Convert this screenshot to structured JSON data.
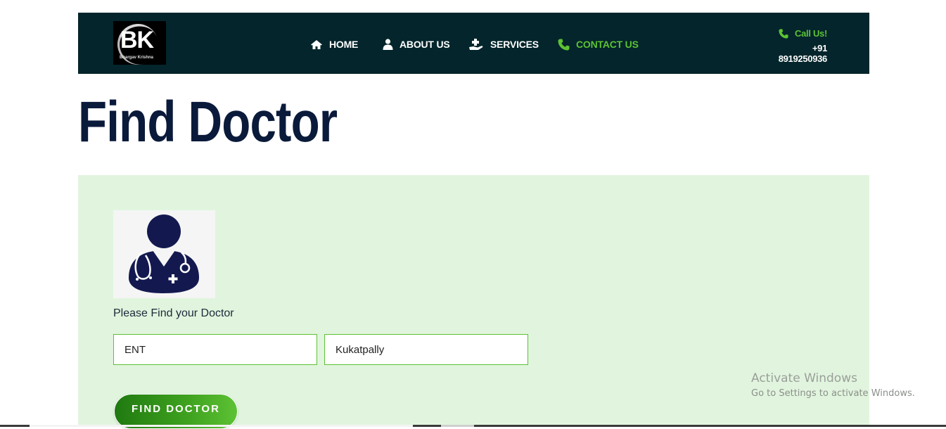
{
  "logo": {
    "letters": "BK",
    "subtitle": "Bhargav Krishna"
  },
  "nav": {
    "home": "HOME",
    "about": "ABOUT US",
    "services": "SERVICES",
    "contact": "CONTACT US"
  },
  "call": {
    "label": "Call Us!",
    "number": "+91 8919250936"
  },
  "page": {
    "title": "Find Doctor"
  },
  "search": {
    "prompt": "Please Find your Doctor",
    "specialty_value": "ENT",
    "location_value": "Kukatpally",
    "button_label": "FIND DOCTOR"
  },
  "watermark": {
    "title": "Activate Windows",
    "subtitle": "Go to Settings to activate Windows."
  },
  "colors": {
    "header_bg": "#03252b",
    "accent_green": "#5dc234",
    "panel_bg": "#e1f5de",
    "title_navy": "#0a1a3a"
  },
  "icons": {
    "home": "home-icon",
    "about": "user-icon",
    "services": "hand-medical-icon",
    "contact": "phone-icon",
    "call": "phone-icon"
  }
}
